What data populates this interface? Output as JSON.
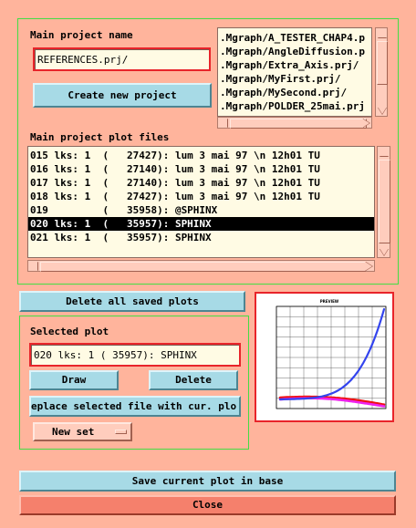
{
  "main_project": {
    "label": "Main project name",
    "value": "REFERENCES.prj/",
    "create_button": "Create new project",
    "files": [
      ".Mgraph/A_TESTER_CHAP4.p",
      ".Mgraph/AngleDiffusion.p",
      ".Mgraph/Extra_Axis.prj/",
      ".Mgraph/MyFirst.prj/",
      ".Mgraph/MySecond.prj/",
      ".Mgraph/POLDER_25mai.prj"
    ]
  },
  "plot_files": {
    "label": "Main project plot files",
    "rows": [
      "015 lks: 1  (   27427): lum 3 mai 97 \\n 12h01 TU",
      "016 lks: 1  (   27140): lum 3 mai 97 \\n 12h01 TU",
      "017 lks: 1  (   27140): lum 3 mai 97 \\n 12h01 TU",
      "018 lks: 1  (   27427): lum 3 mai 97 \\n 12h01 TU",
      "019         (   35958): @SPHINX",
      "020 lks: 1  (   35957): SPHINX",
      "021 lks: 1  (   35957): SPHINX"
    ],
    "selected_index": 5
  },
  "delete_all_button": "Delete all saved plots",
  "selected_plot": {
    "label": "Selected plot",
    "value": "020 lks: 1  (   35957): SPHINX",
    "draw_button": "Draw",
    "delete_button": "Delete",
    "replace_button": "eplace selected file with cur. plo",
    "new_set_button": "New set"
  },
  "preview": {
    "title": "PREVIEW",
    "series_colors": [
      "#3344ee",
      "#ee22ee",
      "#ee1111"
    ],
    "grid": true
  },
  "save_button": "Save current plot in base",
  "close_button": "Close"
}
